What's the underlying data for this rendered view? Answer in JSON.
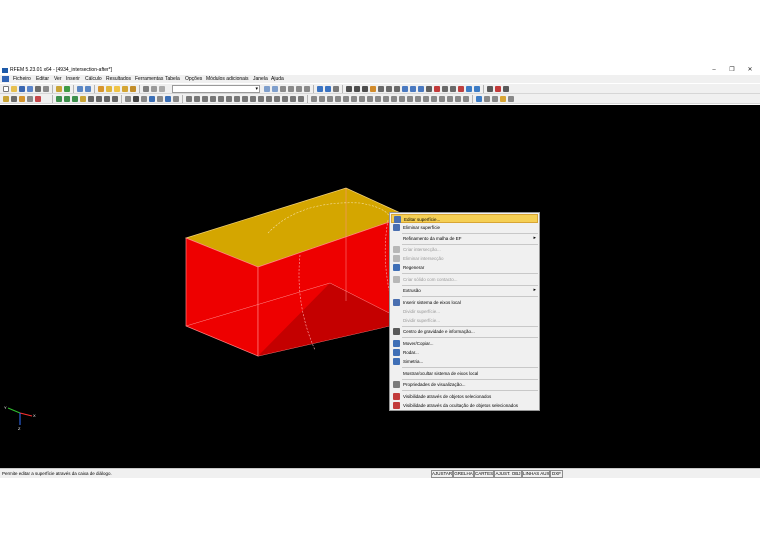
{
  "window": {
    "title": "RFEM 5.23.01 x64 - [4934_intersection-after*]",
    "minimize_glyph": "–",
    "maximize_glyph": "❐",
    "close_glyph": "✕"
  },
  "menubar": {
    "items": [
      "Ficheiro",
      "Editar",
      "Ver",
      "Inserir",
      "Cálculo",
      "Resultados",
      "Ferramentas",
      "Tabela",
      "Opções",
      "Módulos adicionais",
      "Janela",
      "Ajuda"
    ]
  },
  "context_menu": {
    "items": [
      {
        "label": "Editar superfície...",
        "icon": "edit-surface-icon",
        "highlighted": true
      },
      {
        "label": "Eliminar superfície",
        "icon": "delete-surface-icon"
      },
      {
        "label": "Refinamento da malha de EF",
        "submenu": true
      },
      {
        "label": "Criar intersecção...",
        "icon": "create-intersection-icon",
        "disabled": true
      },
      {
        "label": "Eliminar intersecção",
        "icon": "delete-intersection-icon",
        "disabled": true
      },
      {
        "label": "Regenerar",
        "icon": "regenerate-icon"
      },
      {
        "label": "Criar sólido com contacto...",
        "icon": "solid-contact-icon",
        "disabled": true
      },
      {
        "label": "Extrusão",
        "submenu": true
      },
      {
        "label": "Inserir sistema de eixos local",
        "icon": "insert-axis-icon"
      },
      {
        "label": "Dividir superfície...",
        "disabled": true
      },
      {
        "label": "Dividir superfície...",
        "disabled": true
      },
      {
        "label": "Centro de gravidade e informação...",
        "icon": "center-gravity-icon"
      },
      {
        "label": "Mover/Copiar...",
        "icon": "move-copy-icon"
      },
      {
        "label": "Rodar...",
        "icon": "rotate-icon"
      },
      {
        "label": "Simetria...",
        "icon": "mirror-icon"
      },
      {
        "label": "Mostrar/ocultar sistema de eixos local"
      },
      {
        "label": "Propriedades de visualização...",
        "icon": "display-properties-icon"
      },
      {
        "label": "Visibilidade através de objetos selecionados",
        "icon": "visibility-icon"
      },
      {
        "label": "Visibilidade através da ocultação de objetos selecionados",
        "icon": "hide-visibility-icon"
      }
    ]
  },
  "axes": {
    "x": "X",
    "y": "Y",
    "z": "Z"
  },
  "statusbar": {
    "text": "Permite editar a superfície através da caixa de diálogo.",
    "buttons": [
      "AJUSTAR",
      "GRELHA",
      "CARTES",
      "AJUST. OBJ",
      "LINHAS AUX",
      "DXF"
    ]
  },
  "colors": {
    "viewport": "#000000",
    "surface_front": "#ee0000",
    "surface_top": "#d4a600",
    "menu_highlight": "#f5cf54"
  }
}
